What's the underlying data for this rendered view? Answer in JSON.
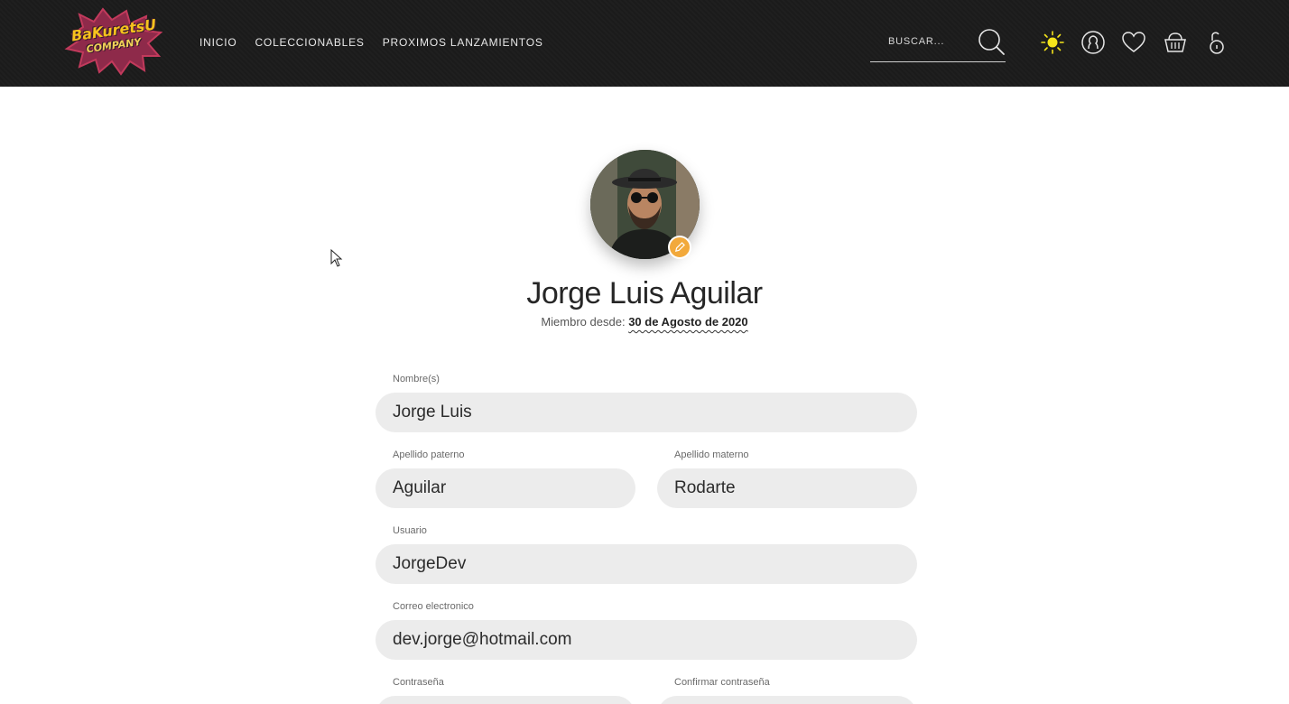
{
  "header": {
    "brand_line1": "BaKuretsU",
    "brand_line2": "COMPANY",
    "nav": [
      "INICIO",
      "COLECCIONABLES",
      "PROXIMOS LANZAMIENTOS"
    ],
    "search_placeholder": "BUSCAR...",
    "icons": [
      "sun-icon",
      "user-icon",
      "heart-icon",
      "basket-icon",
      "lock-icon"
    ],
    "accent_color": "#f5e51b"
  },
  "profile": {
    "name": "Jorge Luis Aguilar",
    "member_since_label": "Miembro desde:",
    "member_since_date": "30 de Agosto de 2020",
    "edit_badge_color": "#f2a93b"
  },
  "form": {
    "nombre": {
      "label": "Nombre(s)",
      "value": "Jorge Luis"
    },
    "apellido_paterno": {
      "label": "Apellido paterno",
      "value": "Aguilar"
    },
    "apellido_materno": {
      "label": "Apellido materno",
      "value": "Rodarte"
    },
    "usuario": {
      "label": "Usuario",
      "value": "JorgeDev"
    },
    "correo": {
      "label": "Correo electronico",
      "value": "dev.jorge@hotmail.com"
    },
    "contrasena": {
      "label": "Contraseña",
      "value": ""
    },
    "confirmar": {
      "label": "Confirmar contraseña",
      "value": ""
    }
  }
}
